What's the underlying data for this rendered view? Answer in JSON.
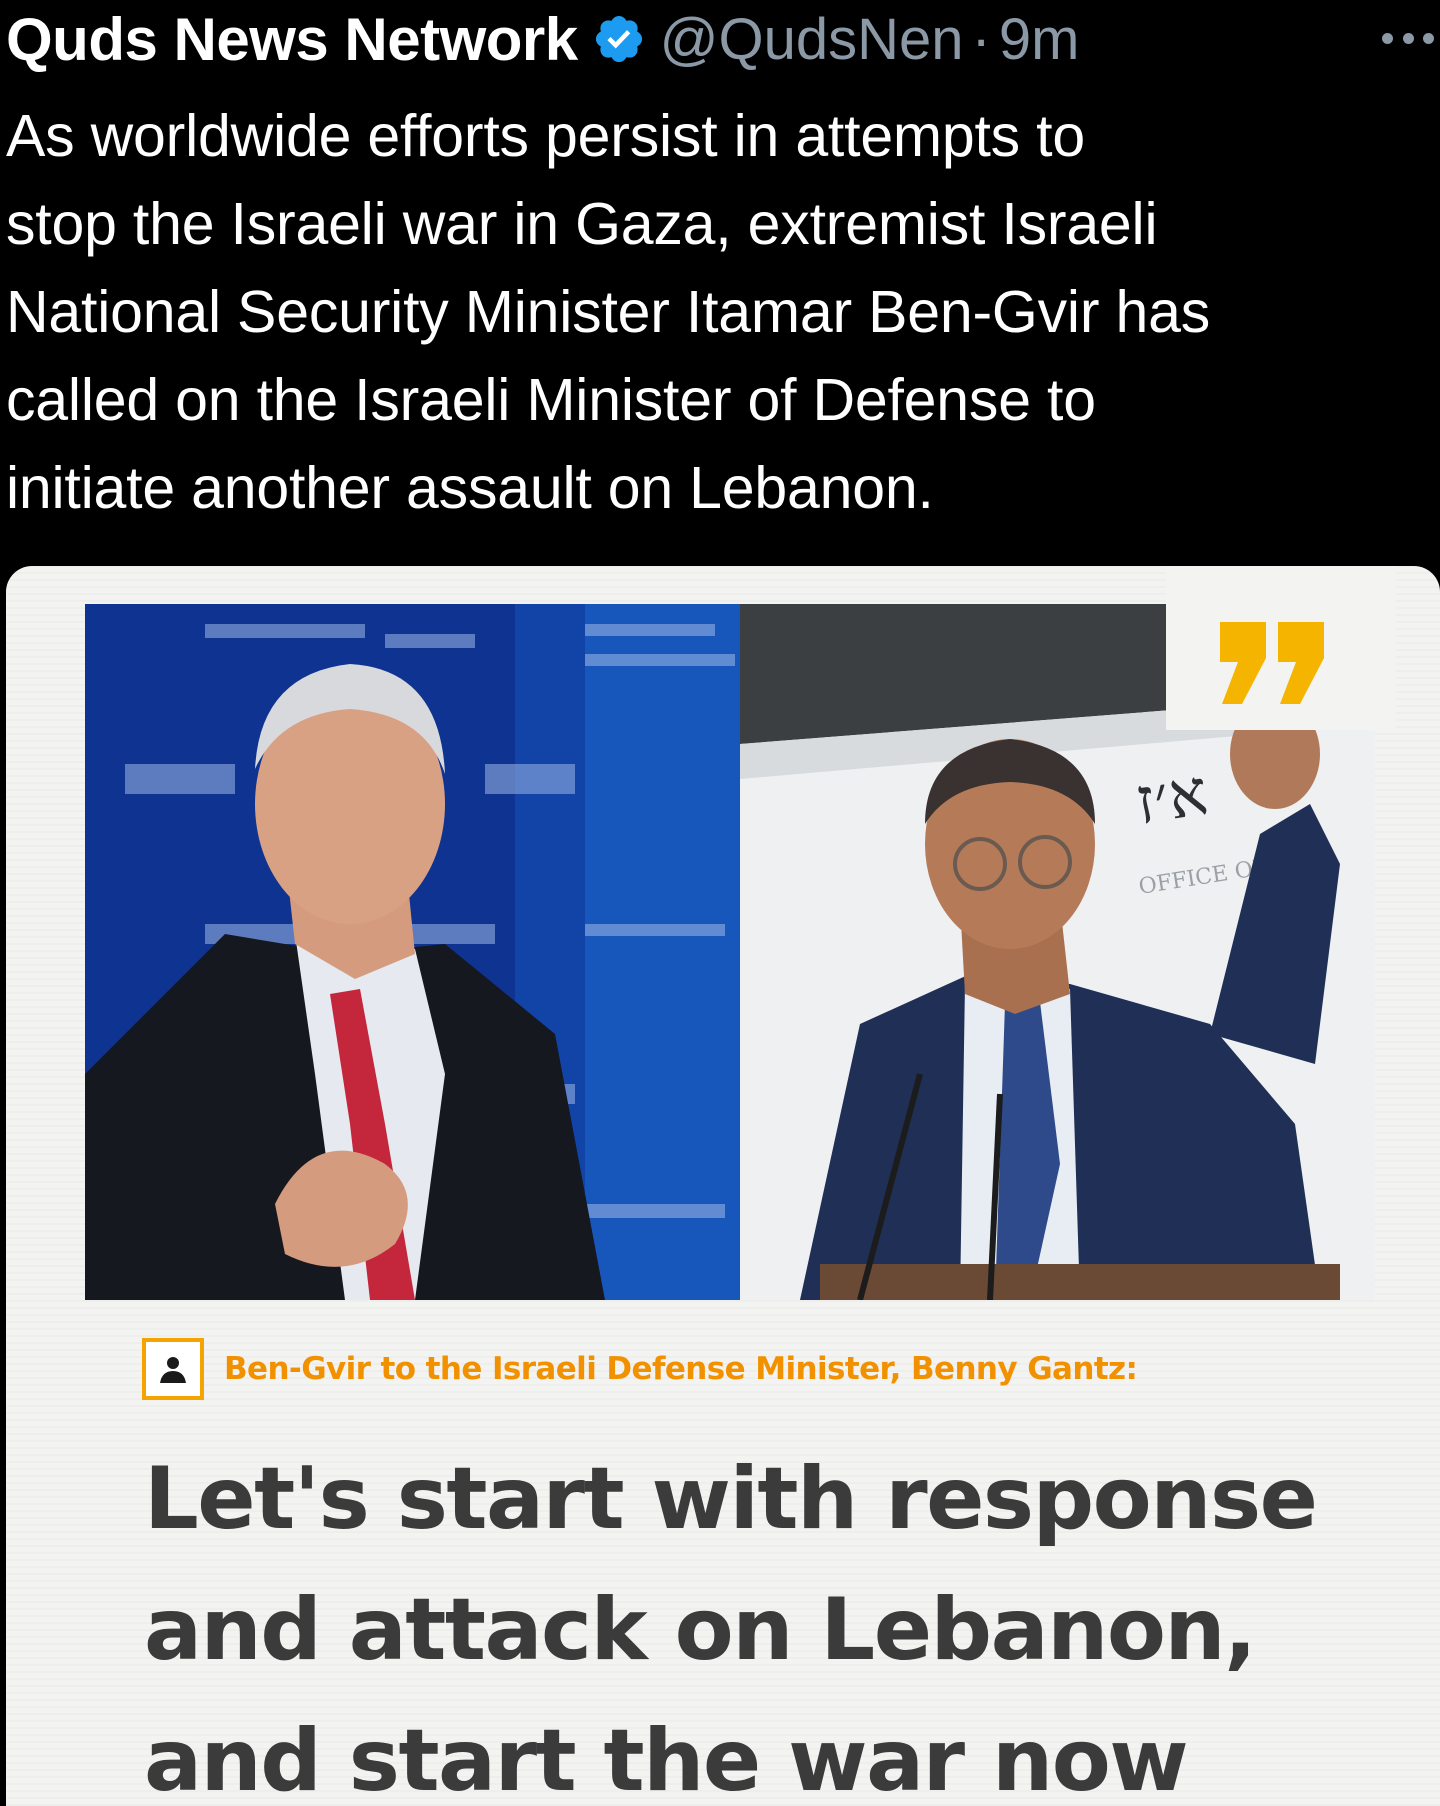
{
  "tweet": {
    "author_name": "Quds News Network",
    "handle": "@QudsNen",
    "separator": "·",
    "time": "9m",
    "text_lines": [
      "As worldwide efforts persist in attempts to",
      "stop the Israeli war in Gaza, extremist Israeli",
      "National Security Minister Itamar Ben-Gvir has",
      "called on the Israeli Minister of Defense to",
      "initiate another assault on Lebanon."
    ],
    "verified_icon": "verified-badge-icon",
    "more_icon": "more-options-icon"
  },
  "media": {
    "attribution": "Ben-Gvir to the Israeli Defense Minister, Benny Gantz:",
    "headline_lines": [
      "Let's start with response",
      "and attack on Lebanon,",
      "and start the war now"
    ],
    "sign_text": "OFFICE OF",
    "person_icon": "person-icon",
    "quote_icon": "quote-mark-icon"
  },
  "colors": {
    "background": "#000000",
    "verified": "#1d9bf0",
    "muted_text": "#8b98a5",
    "accent_orange": "#f29100",
    "quote_yellow": "#f5b400",
    "headline": "#3b3b3b",
    "card_bg": "#f3f3f1"
  }
}
